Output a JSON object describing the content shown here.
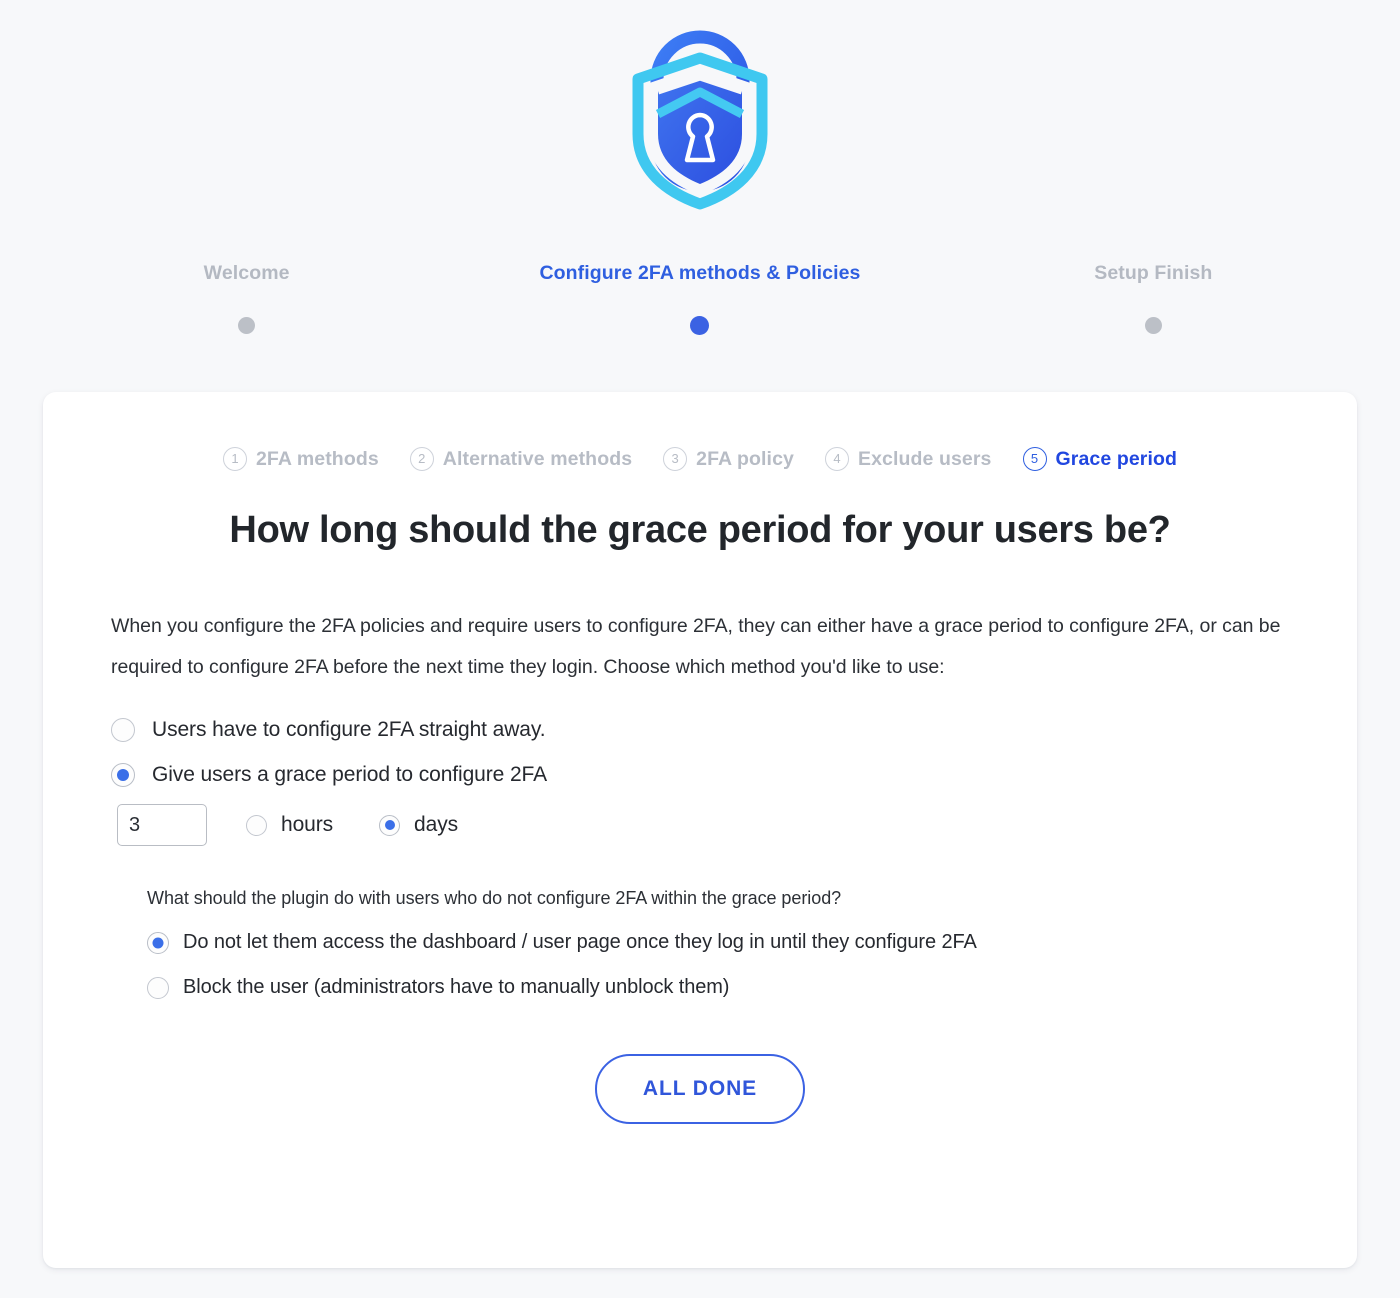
{
  "logo": {
    "name": "two-factor-shield-lock-logo",
    "colors": {
      "shackle_outer": "#2f6bf0",
      "shield_light": "#3ec8f0",
      "shield_fill": "#3461e8",
      "keyhole": "#ffffff"
    }
  },
  "top_steps": [
    {
      "label": "Welcome",
      "active": false
    },
    {
      "label": "Configure 2FA methods & Policies",
      "active": true
    },
    {
      "label": "Setup Finish",
      "active": false
    }
  ],
  "sub_steps": [
    {
      "num": "1",
      "label": "2FA methods",
      "active": false
    },
    {
      "num": "2",
      "label": "Alternative methods",
      "active": false
    },
    {
      "num": "3",
      "label": "2FA policy",
      "active": false
    },
    {
      "num": "4",
      "label": "Exclude users",
      "active": false
    },
    {
      "num": "5",
      "label": "Grace period",
      "active": true
    }
  ],
  "heading": "How long should the grace period for your users be?",
  "intro": "When you configure the 2FA policies and require users to configure 2FA, they can either have a grace period to configure 2FA, or can be required to configure 2FA before the next time they login. Choose which method you'd like to use:",
  "grace_options": [
    {
      "label": "Users have to configure 2FA straight away.",
      "checked": false
    },
    {
      "label": "Give users a grace period to configure 2FA",
      "checked": true
    }
  ],
  "duration": {
    "value": "3",
    "placeholder": "",
    "units": [
      {
        "label": "hours",
        "checked": false
      },
      {
        "label": "days",
        "checked": true
      }
    ]
  },
  "sub_question": "What should the plugin do with users who do not configure 2FA within the grace period?",
  "expiry_options": [
    {
      "label": "Do not let them access the dashboard / user page once they log in until they configure 2FA",
      "checked": true
    },
    {
      "label": "Block the user (administrators have to manually unblock them)",
      "checked": false
    }
  ],
  "primary_button": "ALL DONE",
  "colors": {
    "accent": "#3b62e3",
    "accent_text": "#2147e0",
    "muted": "#b7bcc5",
    "page_bg": "#f7f8fa",
    "card_bg": "#ffffff"
  }
}
